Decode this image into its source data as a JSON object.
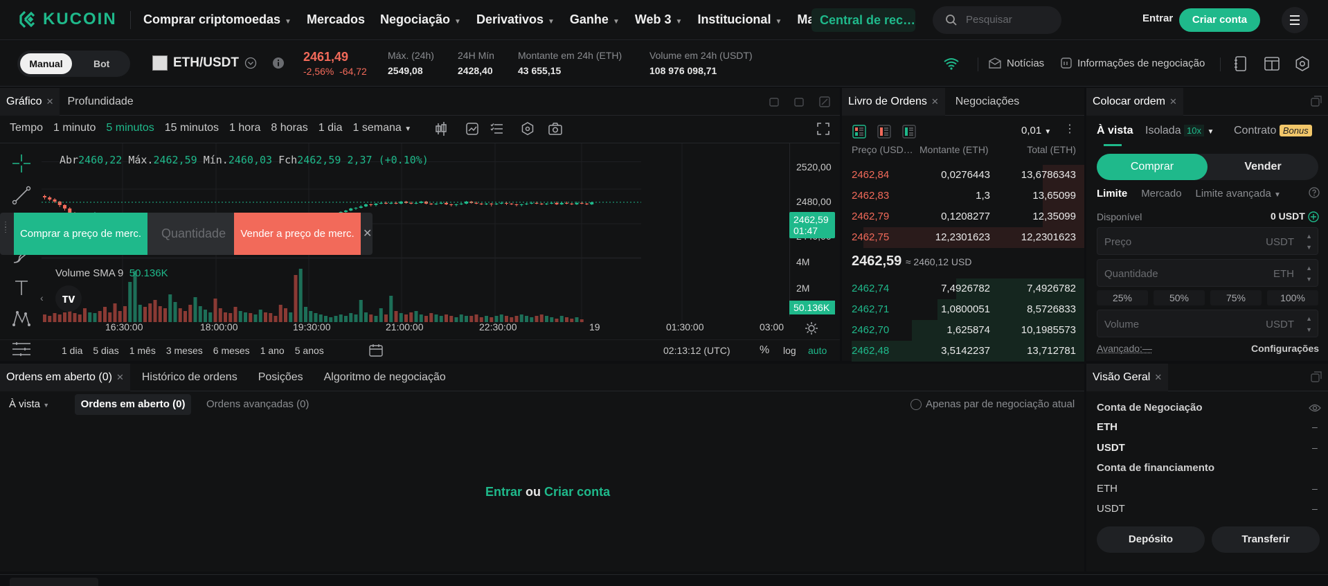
{
  "nav": {
    "logo": "KUCOIN",
    "items": [
      "Comprar criptomoedas",
      "Mercados",
      "Negociação",
      "Derivativos",
      "Ganhe",
      "Web 3",
      "Institucional",
      "Mais"
    ],
    "central": "Central de rec…",
    "search_placeholder": "Pesquisar",
    "login": "Entrar",
    "signup": "Criar conta"
  },
  "ticker": {
    "mode_manual": "Manual",
    "mode_bot": "Bot",
    "pair": "ETH/USDT",
    "price": "2461,49",
    "change_pct": "-2,56%",
    "change_abs": "-64,72",
    "high_label": "Máx. (24h)",
    "high": "2549,08",
    "low_label": "24H Mín",
    "low": "2428,40",
    "amount_label": "Montante em 24h (ETH)",
    "amount": "43 655,15",
    "volume_label": "Volume em 24h (USDT)",
    "volume": "108 976 098,71",
    "news": "Notícias",
    "info": "Informações de negociação"
  },
  "chart": {
    "tabs": [
      "Gráfico",
      "Profundidade"
    ],
    "timeframes": [
      "Tempo",
      "1 minuto",
      "5 minutos",
      "15 minutos",
      "1 hora",
      "8 horas",
      "1 dia",
      "1 semana"
    ],
    "active_tf": "5 minutos",
    "ohlc": {
      "o_label": "Abr",
      "o": "2460,22",
      "h_label": "Máx.",
      "h": "2462,59",
      "l_label": "Mín.",
      "l": "2460,03",
      "c_label": "Fch",
      "c": "2462,59",
      "chg": "2,37 (+0.10%)"
    },
    "volume_label": "Volume SMA 9",
    "volume_val": "50.136K",
    "price_ticks": [
      "2520,00",
      "2480,00",
      "2440,00"
    ],
    "vol_ticks": [
      "4M",
      "2M"
    ],
    "last_price": "2462,59",
    "countdown": "01:47",
    "vol_tag": "50.136K",
    "time_ticks": [
      "16:30:00",
      "18:00:00",
      "19:30:00",
      "21:00:00",
      "22:30:00",
      "19",
      "01:30:00",
      "03:00"
    ],
    "ranges": [
      "1 dia",
      "5 dias",
      "1 mês",
      "3 meses",
      "6 meses",
      "1 ano",
      "5 anos"
    ],
    "clock": "02:13:12 (UTC)",
    "pct": "%",
    "log": "log",
    "auto": "auto",
    "quick_buy": "Comprar a preço de merc.",
    "quick_qty": "Quantidade",
    "quick_sell": "Vender a preço de merc.",
    "candles": [
      [
        2469.5,
        2468,
        2466,
        2471
      ],
      [
        2468,
        2466,
        2464,
        2469.5
      ],
      [
        2466,
        2463,
        2462,
        2467
      ],
      [
        2463,
        2459,
        2457,
        2464
      ],
      [
        2459,
        2455,
        2453,
        2460
      ],
      [
        2455,
        2450,
        2448,
        2457
      ],
      [
        2450,
        2447,
        2445,
        2451
      ],
      [
        2447,
        2445,
        2443,
        2448
      ],
      [
        2445,
        2444,
        2442,
        2446
      ],
      [
        2444,
        2446,
        2443,
        2448
      ],
      [
        2446,
        2449,
        2445,
        2451
      ],
      [
        2449,
        2446,
        2444,
        2450
      ],
      [
        2446,
        2443,
        2441,
        2447
      ],
      [
        2443,
        2440,
        2438,
        2444
      ],
      [
        2440,
        2437,
        2434,
        2441
      ],
      [
        2437,
        2436,
        2433,
        2438
      ],
      [
        2436,
        2435,
        2432,
        2437
      ],
      [
        2435,
        2438,
        2434,
        2440
      ],
      [
        2438,
        2441,
        2437,
        2442
      ],
      [
        2441,
        2443,
        2440,
        2444
      ],
      [
        2443,
        2441,
        2439,
        2444
      ],
      [
        2441,
        2438,
        2436,
        2442
      ],
      [
        2438,
        2435,
        2433,
        2439
      ],
      [
        2435,
        2433,
        2431,
        2436
      ],
      [
        2433,
        2432,
        2430,
        2434
      ],
      [
        2432,
        2433,
        2431,
        2435
      ],
      [
        2433,
        2434,
        2432,
        2436
      ],
      [
        2434,
        2433,
        2431,
        2435
      ],
      [
        2433,
        2432,
        2430,
        2434
      ],
      [
        2432,
        2430,
        2428,
        2433
      ],
      [
        2430,
        2431,
        2429,
        2432
      ],
      [
        2431,
        2433,
        2430,
        2434
      ],
      [
        2433,
        2436,
        2432,
        2437
      ],
      [
        2436,
        2439,
        2435,
        2440
      ],
      [
        2439,
        2437,
        2435,
        2440
      ],
      [
        2437,
        2436,
        2434,
        2438
      ],
      [
        2436,
        2434,
        2433,
        2437
      ],
      [
        2434,
        2432,
        2431,
        2435
      ],
      [
        2432,
        2430,
        2429,
        2433
      ],
      [
        2430,
        2431,
        2429,
        2432
      ],
      [
        2431,
        2432,
        2430,
        2433
      ],
      [
        2432,
        2431,
        2429,
        2433
      ],
      [
        2431,
        2432,
        2430,
        2434
      ],
      [
        2432,
        2434,
        2431,
        2435
      ],
      [
        2434,
        2433,
        2432,
        2435
      ],
      [
        2433,
        2432,
        2430,
        2434
      ],
      [
        2432,
        2431,
        2429,
        2433
      ],
      [
        2431,
        2430,
        2428,
        2432
      ],
      [
        2430,
        2429,
        2427,
        2431
      ],
      [
        2429,
        2430,
        2428,
        2431
      ],
      [
        2430,
        2428,
        2426,
        2431
      ],
      [
        2428,
        2430,
        2427,
        2431
      ],
      [
        2430,
        2433,
        2429,
        2434
      ],
      [
        2433,
        2437,
        2432,
        2438
      ],
      [
        2437,
        2440,
        2436,
        2442
      ],
      [
        2440,
        2443,
        2439,
        2444
      ],
      [
        2443,
        2445,
        2442,
        2446
      ],
      [
        2445,
        2447,
        2444,
        2448
      ],
      [
        2447,
        2449,
        2446,
        2450
      ],
      [
        2449,
        2451,
        2448,
        2452
      ],
      [
        2451,
        2453,
        2450,
        2454
      ],
      [
        2453,
        2455,
        2452,
        2456
      ],
      [
        2455,
        2456,
        2454,
        2457
      ],
      [
        2456,
        2458,
        2455,
        2459
      ],
      [
        2458,
        2460,
        2457,
        2461
      ],
      [
        2460,
        2459,
        2458,
        2461
      ],
      [
        2459,
        2461,
        2458,
        2462
      ],
      [
        2461,
        2462,
        2460,
        2463
      ],
      [
        2462,
        2461,
        2460,
        2463
      ],
      [
        2461,
        2462,
        2460,
        2463
      ],
      [
        2462,
        2461,
        2460,
        2463
      ],
      [
        2461,
        2463,
        2460,
        2464
      ],
      [
        2463,
        2462,
        2461,
        2464
      ],
      [
        2462,
        2461,
        2460,
        2463
      ],
      [
        2461,
        2462,
        2460,
        2463
      ],
      [
        2462,
        2463,
        2461,
        2464
      ],
      [
        2463,
        2461,
        2460,
        2464
      ],
      [
        2461,
        2460,
        2459,
        2462
      ],
      [
        2460,
        2461,
        2459,
        2462
      ],
      [
        2461,
        2462,
        2460,
        2463
      ],
      [
        2462,
        2460,
        2459,
        2463
      ],
      [
        2460,
        2459,
        2458,
        2461
      ],
      [
        2459,
        2460,
        2458,
        2461
      ],
      [
        2460,
        2461,
        2459,
        2462
      ],
      [
        2461,
        2463,
        2460,
        2464
      ],
      [
        2463,
        2462,
        2461,
        2464
      ],
      [
        2462,
        2461,
        2460,
        2463
      ],
      [
        2461,
        2460,
        2459,
        2462
      ],
      [
        2460,
        2461,
        2459,
        2462
      ],
      [
        2461,
        2460,
        2458,
        2462
      ],
      [
        2460,
        2461,
        2459,
        2462
      ],
      [
        2461,
        2462,
        2460,
        2463
      ],
      [
        2462,
        2461,
        2459,
        2463
      ],
      [
        2461,
        2460,
        2459,
        2462
      ],
      [
        2460,
        2459,
        2458,
        2461
      ],
      [
        2459,
        2460,
        2458,
        2461
      ],
      [
        2460,
        2461,
        2459,
        2462
      ],
      [
        2461,
        2462,
        2460,
        2463
      ],
      [
        2462,
        2461,
        2460,
        2463
      ],
      [
        2461,
        2460,
        2459,
        2462
      ],
      [
        2460,
        2461,
        2459,
        2462
      ],
      [
        2461,
        2462,
        2460,
        2463
      ],
      [
        2462,
        2460,
        2459,
        2463
      ],
      [
        2460,
        2462,
        2459,
        2463
      ],
      [
        2462,
        2461,
        2460,
        2463
      ],
      [
        2461,
        2460,
        2459,
        2462
      ],
      [
        2460,
        2462,
        2459,
        2463
      ],
      [
        2462,
        2461,
        2460,
        2463
      ],
      [
        2461,
        2460,
        2459,
        2462
      ],
      [
        2460,
        2462.59,
        2459,
        2463
      ]
    ],
    "volumes": [
      0.6,
      0.5,
      0.7,
      0.6,
      0.8,
      0.9,
      0.7,
      0.6,
      1.1,
      0.8,
      0.7,
      0.9,
      1.2,
      0.8,
      1.5,
      0.9,
      1.3,
      3.2,
      4.1,
      1.4,
      1.2,
      1.5,
      1.8,
      1.3,
      1.1,
      2.2,
      1.6,
      1.1,
      0.9,
      1.4,
      2.0,
      1.3,
      1.0,
      0.8,
      1.9,
      1.1,
      0.8,
      0.7,
      1.2,
      0.9,
      0.8,
      0.7,
      0.6,
      1.0,
      0.8,
      0.7,
      0.5,
      1.4,
      1.1,
      0.8,
      3.8,
      4.3,
      1.2,
      0.9,
      0.7,
      0.6,
      0.5,
      0.4,
      0.5,
      0.6,
      0.5,
      0.7,
      0.6,
      1.8,
      0.8,
      0.6,
      0.5,
      1.1,
      0.6,
      2.1,
      0.9,
      0.7,
      0.6,
      0.8,
      0.9,
      0.6,
      0.5,
      0.7,
      0.6,
      0.5,
      0.6,
      0.5,
      0.4,
      0.6,
      0.5,
      0.5,
      0.6,
      0.4,
      0.5,
      0.4,
      0.5,
      0.6,
      0.5,
      0.4,
      0.5,
      0.6,
      0.5,
      0.4,
      0.5,
      0.6,
      0.5,
      0.4,
      0.3,
      0.5,
      0.4,
      0.3,
      0.4,
      0.2
    ]
  },
  "orderbook": {
    "tabs": [
      "Livro de Ordens",
      "Negociações"
    ],
    "precision": "0,01",
    "cols": [
      "Preço (USD…",
      "Montante (ETH)",
      "Total (ETH)"
    ],
    "asks": [
      [
        "2462,84",
        "0,0276443",
        "13,6786343"
      ],
      [
        "2462,83",
        "1,3",
        "13,65099"
      ],
      [
        "2462,79",
        "0,1208277",
        "12,35099"
      ],
      [
        "2462,75",
        "12,2301623",
        "12,2301623"
      ]
    ],
    "mid": "2462,59",
    "mid_usd": "≈ 2460,12 USD",
    "bids": [
      [
        "2462,74",
        "7,4926782",
        "7,4926782"
      ],
      [
        "2462,71",
        "1,0800051",
        "8,5726833"
      ],
      [
        "2462,70",
        "1,625874",
        "10,1985573"
      ],
      [
        "2462,48",
        "3,5142237",
        "13,712781"
      ]
    ],
    "ask_depth": [
      0.18,
      0.18,
      0.18,
      0.95
    ],
    "bid_depth": [
      0.55,
      0.63,
      0.74,
      1.0
    ]
  },
  "order": {
    "title": "Colocar ordem",
    "tabs": [
      "À vista",
      "Isolada",
      "Contrato"
    ],
    "leverage": "10x",
    "bonus": "Bonus",
    "buy": "Comprar",
    "sell": "Vender",
    "types": [
      "Limite",
      "Mercado",
      "Limite avançada"
    ],
    "available_label": "Disponível",
    "available": "0 USDT",
    "price_ph": "Preço",
    "qty_ph": "Quantidade",
    "vol_ph": "Volume",
    "usdt": "USDT",
    "eth": "ETH",
    "pcts": [
      "25%",
      "50%",
      "75%",
      "100%"
    ],
    "advanced": "Avançado:—",
    "settings": "Configurações"
  },
  "orders": {
    "tabs": [
      "Ordens em aberto (0)",
      "Histórico de ordens",
      "Posições",
      "Algoritmo de negociação"
    ],
    "filter": "À vista",
    "subtabs": [
      "Ordens em aberto (0)",
      "Ordens avançadas (0)"
    ],
    "only_pair": "Apenas par de negociação atual",
    "login": "Entrar",
    "or": "ou",
    "signup": "Criar conta"
  },
  "overview": {
    "title": "Visão Geral",
    "trading": "Conta de Negociação",
    "funding": "Conta de financiamento",
    "assets": [
      "ETH",
      "USDT"
    ],
    "dash": "–",
    "deposit": "Depósito",
    "transfer": "Transferir"
  },
  "colors": {
    "green": "#1fb98b",
    "red": "#f26a5a",
    "bg": "#0e0f11",
    "panel": "#121314"
  }
}
